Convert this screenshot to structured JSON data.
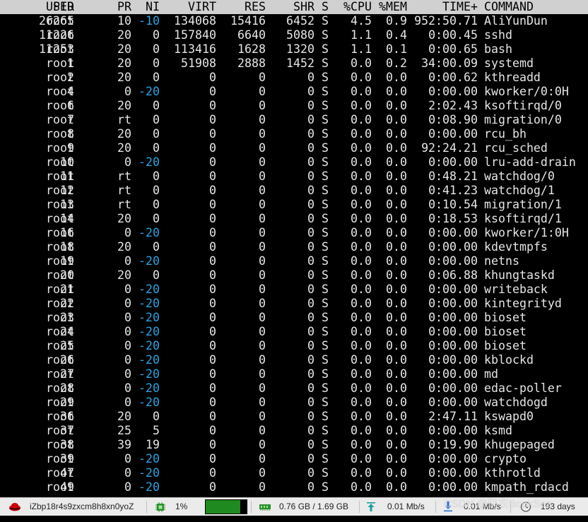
{
  "header": {
    "pid": "PID",
    "user": "USER",
    "pr": "PR",
    "ni": "NI",
    "virt": "VIRT",
    "res": "RES",
    "shr": "SHR",
    "s": "S",
    "cpu": "%CPU",
    "mem": "%MEM",
    "time": "TIME+",
    "cmd": "COMMAND"
  },
  "processes": [
    {
      "pid": "26265",
      "user": "root",
      "pr": "10",
      "ni": "-10",
      "virt": "134068",
      "res": "15416",
      "shr": "6452",
      "s": "S",
      "cpu": "4.5",
      "mem": "0.9",
      "time": "952:50.71",
      "cmd": "AliYunDun"
    },
    {
      "pid": "11226",
      "user": "root",
      "pr": "20",
      "ni": "0",
      "virt": "157840",
      "res": "6640",
      "shr": "5080",
      "s": "S",
      "cpu": "1.1",
      "mem": "0.4",
      "time": "0:00.45",
      "cmd": "sshd"
    },
    {
      "pid": "11253",
      "user": "root",
      "pr": "20",
      "ni": "0",
      "virt": "113416",
      "res": "1628",
      "shr": "1320",
      "s": "S",
      "cpu": "1.1",
      "mem": "0.1",
      "time": "0:00.65",
      "cmd": "bash"
    },
    {
      "pid": "1",
      "user": "root",
      "pr": "20",
      "ni": "0",
      "virt": "51908",
      "res": "2888",
      "shr": "1452",
      "s": "S",
      "cpu": "0.0",
      "mem": "0.2",
      "time": "34:00.09",
      "cmd": "systemd"
    },
    {
      "pid": "2",
      "user": "root",
      "pr": "20",
      "ni": "0",
      "virt": "0",
      "res": "0",
      "shr": "0",
      "s": "S",
      "cpu": "0.0",
      "mem": "0.0",
      "time": "0:00.62",
      "cmd": "kthreadd"
    },
    {
      "pid": "4",
      "user": "root",
      "pr": "0",
      "ni": "-20",
      "virt": "0",
      "res": "0",
      "shr": "0",
      "s": "S",
      "cpu": "0.0",
      "mem": "0.0",
      "time": "0:00.00",
      "cmd": "kworker/0:0H"
    },
    {
      "pid": "6",
      "user": "root",
      "pr": "20",
      "ni": "0",
      "virt": "0",
      "res": "0",
      "shr": "0",
      "s": "S",
      "cpu": "0.0",
      "mem": "0.0",
      "time": "2:02.43",
      "cmd": "ksoftirqd/0"
    },
    {
      "pid": "7",
      "user": "root",
      "pr": "rt",
      "ni": "0",
      "virt": "0",
      "res": "0",
      "shr": "0",
      "s": "S",
      "cpu": "0.0",
      "mem": "0.0",
      "time": "0:08.90",
      "cmd": "migration/0"
    },
    {
      "pid": "8",
      "user": "root",
      "pr": "20",
      "ni": "0",
      "virt": "0",
      "res": "0",
      "shr": "0",
      "s": "S",
      "cpu": "0.0",
      "mem": "0.0",
      "time": "0:00.00",
      "cmd": "rcu_bh"
    },
    {
      "pid": "9",
      "user": "root",
      "pr": "20",
      "ni": "0",
      "virt": "0",
      "res": "0",
      "shr": "0",
      "s": "S",
      "cpu": "0.0",
      "mem": "0.0",
      "time": "92:24.21",
      "cmd": "rcu_sched"
    },
    {
      "pid": "10",
      "user": "root",
      "pr": "0",
      "ni": "-20",
      "virt": "0",
      "res": "0",
      "shr": "0",
      "s": "S",
      "cpu": "0.0",
      "mem": "0.0",
      "time": "0:00.00",
      "cmd": "lru-add-drain"
    },
    {
      "pid": "11",
      "user": "root",
      "pr": "rt",
      "ni": "0",
      "virt": "0",
      "res": "0",
      "shr": "0",
      "s": "S",
      "cpu": "0.0",
      "mem": "0.0",
      "time": "0:48.21",
      "cmd": "watchdog/0"
    },
    {
      "pid": "12",
      "user": "root",
      "pr": "rt",
      "ni": "0",
      "virt": "0",
      "res": "0",
      "shr": "0",
      "s": "S",
      "cpu": "0.0",
      "mem": "0.0",
      "time": "0:41.23",
      "cmd": "watchdog/1"
    },
    {
      "pid": "13",
      "user": "root",
      "pr": "rt",
      "ni": "0",
      "virt": "0",
      "res": "0",
      "shr": "0",
      "s": "S",
      "cpu": "0.0",
      "mem": "0.0",
      "time": "0:10.54",
      "cmd": "migration/1"
    },
    {
      "pid": "14",
      "user": "root",
      "pr": "20",
      "ni": "0",
      "virt": "0",
      "res": "0",
      "shr": "0",
      "s": "S",
      "cpu": "0.0",
      "mem": "0.0",
      "time": "0:18.53",
      "cmd": "ksoftirqd/1"
    },
    {
      "pid": "16",
      "user": "root",
      "pr": "0",
      "ni": "-20",
      "virt": "0",
      "res": "0",
      "shr": "0",
      "s": "S",
      "cpu": "0.0",
      "mem": "0.0",
      "time": "0:00.00",
      "cmd": "kworker/1:0H"
    },
    {
      "pid": "18",
      "user": "root",
      "pr": "20",
      "ni": "0",
      "virt": "0",
      "res": "0",
      "shr": "0",
      "s": "S",
      "cpu": "0.0",
      "mem": "0.0",
      "time": "0:00.00",
      "cmd": "kdevtmpfs"
    },
    {
      "pid": "19",
      "user": "root",
      "pr": "0",
      "ni": "-20",
      "virt": "0",
      "res": "0",
      "shr": "0",
      "s": "S",
      "cpu": "0.0",
      "mem": "0.0",
      "time": "0:00.00",
      "cmd": "netns"
    },
    {
      "pid": "20",
      "user": "root",
      "pr": "20",
      "ni": "0",
      "virt": "0",
      "res": "0",
      "shr": "0",
      "s": "S",
      "cpu": "0.0",
      "mem": "0.0",
      "time": "0:06.88",
      "cmd": "khungtaskd"
    },
    {
      "pid": "21",
      "user": "root",
      "pr": "0",
      "ni": "-20",
      "virt": "0",
      "res": "0",
      "shr": "0",
      "s": "S",
      "cpu": "0.0",
      "mem": "0.0",
      "time": "0:00.00",
      "cmd": "writeback"
    },
    {
      "pid": "22",
      "user": "root",
      "pr": "0",
      "ni": "-20",
      "virt": "0",
      "res": "0",
      "shr": "0",
      "s": "S",
      "cpu": "0.0",
      "mem": "0.0",
      "time": "0:00.00",
      "cmd": "kintegrityd"
    },
    {
      "pid": "23",
      "user": "root",
      "pr": "0",
      "ni": "-20",
      "virt": "0",
      "res": "0",
      "shr": "0",
      "s": "S",
      "cpu": "0.0",
      "mem": "0.0",
      "time": "0:00.00",
      "cmd": "bioset"
    },
    {
      "pid": "24",
      "user": "root",
      "pr": "0",
      "ni": "-20",
      "virt": "0",
      "res": "0",
      "shr": "0",
      "s": "S",
      "cpu": "0.0",
      "mem": "0.0",
      "time": "0:00.00",
      "cmd": "bioset"
    },
    {
      "pid": "25",
      "user": "root",
      "pr": "0",
      "ni": "-20",
      "virt": "0",
      "res": "0",
      "shr": "0",
      "s": "S",
      "cpu": "0.0",
      "mem": "0.0",
      "time": "0:00.00",
      "cmd": "bioset"
    },
    {
      "pid": "26",
      "user": "root",
      "pr": "0",
      "ni": "-20",
      "virt": "0",
      "res": "0",
      "shr": "0",
      "s": "S",
      "cpu": "0.0",
      "mem": "0.0",
      "time": "0:00.00",
      "cmd": "kblockd"
    },
    {
      "pid": "27",
      "user": "root",
      "pr": "0",
      "ni": "-20",
      "virt": "0",
      "res": "0",
      "shr": "0",
      "s": "S",
      "cpu": "0.0",
      "mem": "0.0",
      "time": "0:00.00",
      "cmd": "md"
    },
    {
      "pid": "28",
      "user": "root",
      "pr": "0",
      "ni": "-20",
      "virt": "0",
      "res": "0",
      "shr": "0",
      "s": "S",
      "cpu": "0.0",
      "mem": "0.0",
      "time": "0:00.00",
      "cmd": "edac-poller"
    },
    {
      "pid": "29",
      "user": "root",
      "pr": "0",
      "ni": "-20",
      "virt": "0",
      "res": "0",
      "shr": "0",
      "s": "S",
      "cpu": "0.0",
      "mem": "0.0",
      "time": "0:00.00",
      "cmd": "watchdogd"
    },
    {
      "pid": "36",
      "user": "root",
      "pr": "20",
      "ni": "0",
      "virt": "0",
      "res": "0",
      "shr": "0",
      "s": "S",
      "cpu": "0.0",
      "mem": "0.0",
      "time": "2:47.11",
      "cmd": "kswapd0"
    },
    {
      "pid": "37",
      "user": "root",
      "pr": "25",
      "ni": "5",
      "virt": "0",
      "res": "0",
      "shr": "0",
      "s": "S",
      "cpu": "0.0",
      "mem": "0.0",
      "time": "0:00.00",
      "cmd": "ksmd"
    },
    {
      "pid": "38",
      "user": "root",
      "pr": "39",
      "ni": "19",
      "virt": "0",
      "res": "0",
      "shr": "0",
      "s": "S",
      "cpu": "0.0",
      "mem": "0.0",
      "time": "0:19.90",
      "cmd": "khugepaged"
    },
    {
      "pid": "39",
      "user": "root",
      "pr": "0",
      "ni": "-20",
      "virt": "0",
      "res": "0",
      "shr": "0",
      "s": "S",
      "cpu": "0.0",
      "mem": "0.0",
      "time": "0:00.00",
      "cmd": "crypto"
    },
    {
      "pid": "47",
      "user": "root",
      "pr": "0",
      "ni": "-20",
      "virt": "0",
      "res": "0",
      "shr": "0",
      "s": "S",
      "cpu": "0.0",
      "mem": "0.0",
      "time": "0:00.00",
      "cmd": "kthrotld"
    },
    {
      "pid": "49",
      "user": "root",
      "pr": "0",
      "ni": "-20",
      "virt": "0",
      "res": "0",
      "shr": "0",
      "s": "S",
      "cpu": "0.0",
      "mem": "0.0",
      "time": "0:00.00",
      "cmd": "kmpath_rdacd"
    }
  ],
  "statusbar": {
    "hostname": "iZbp18r4s9zxcm8h8xn0yoZ",
    "host_icon": "redhat-icon",
    "cpu_icon": "cpu-chip-icon",
    "cpu": "1%",
    "cpu_fill": 0.85,
    "mem_icon": "memory-icon",
    "memory": "0.76 GB / 1.69 GB",
    "upload_icon": "upload-arrow-icon",
    "upload": "0.01 Mb/s",
    "download_icon": "download-arrow-icon",
    "download": "0.01 Mb/s",
    "uptime_icon": "clock-icon",
    "uptime": "193 days",
    "watermark": "CSDN @码农BookSea"
  },
  "colors": {
    "negative_nice": "#2aa3e0",
    "header_bg": "#d0d0d0",
    "terminal_bg": "#000000",
    "fg": "#e6e6e6",
    "cpu_bar": "#1f8a1f"
  }
}
